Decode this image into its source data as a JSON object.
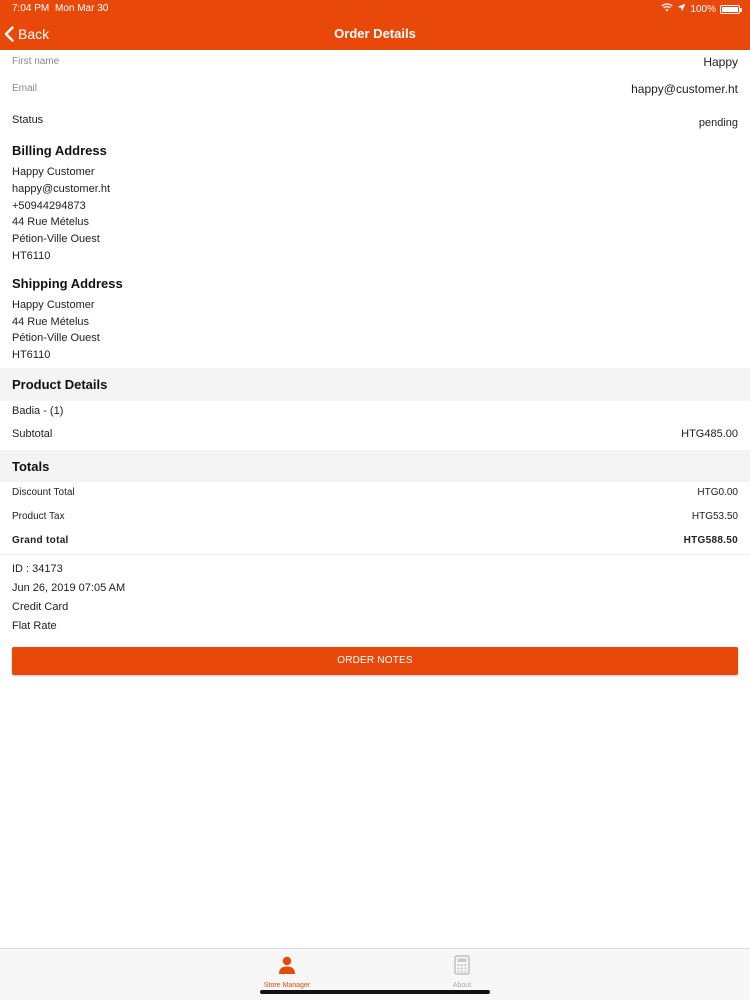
{
  "status_bar": {
    "time": "7:04 PM",
    "date": "Mon Mar 30",
    "battery": "100%"
  },
  "header": {
    "back_label": "Back",
    "title": "Order Details"
  },
  "customer": {
    "first_name_label": "First name",
    "first_name": "Happy",
    "email_label": "Email",
    "email": "happy@customer.ht",
    "status_label": "Status",
    "status": "pending"
  },
  "billing": {
    "title": "Billing Address",
    "lines": [
      "Happy Customer",
      "happy@customer.ht",
      "+50944294873",
      "44 Rue Mételus",
      "Pétion-Ville Ouest",
      "HT6110"
    ]
  },
  "shipping": {
    "title": "Shipping Address",
    "lines": [
      "Happy Customer",
      "44 Rue Mételus",
      "Pétion-Ville Ouest",
      "HT6110"
    ]
  },
  "product_details": {
    "title": "Product Details",
    "item": "Badia - (1)",
    "subtotal_label": "Subtotal",
    "subtotal": "HTG485.00"
  },
  "totals": {
    "title": "Totals",
    "discount_label": "Discount Total",
    "discount": "HTG0.00",
    "tax_label": "Product Tax",
    "tax": "HTG53.50",
    "grand_label": "Grand total",
    "grand": "HTG588.50"
  },
  "order_meta": {
    "id": "ID : 34173",
    "date": "Jun 26, 2019 07:05 AM",
    "payment": "Credit Card",
    "shipping_method": "Flat Rate"
  },
  "order_notes_button": "ORDER NOTES",
  "tabbar": {
    "tabs": [
      {
        "label": "Store Manager",
        "icon": "person-icon",
        "active": true
      },
      {
        "label": "About",
        "icon": "calculator-icon",
        "active": false
      }
    ]
  },
  "colors": {
    "accent": "#e8490b",
    "band": "#f4f4f4"
  }
}
